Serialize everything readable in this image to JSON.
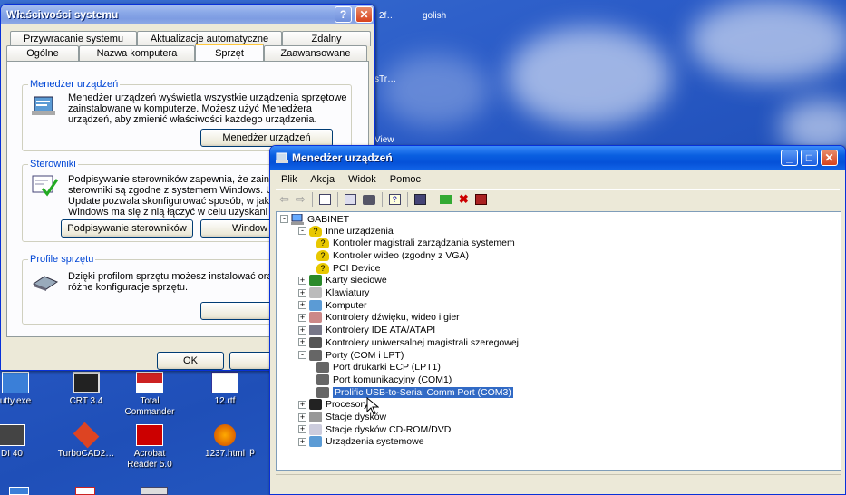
{
  "desktop": {
    "top_labels": [
      "2f…",
      "golish"
    ],
    "side_labels": [
      "sTr…",
      "View"
    ],
    "icons": [
      {
        "label": "utty.exe"
      },
      {
        "label": "CRT 3.4"
      },
      {
        "label": "Total Commander"
      },
      {
        "label": "12.rtf"
      },
      {
        "label": "DI 40"
      },
      {
        "label": "TurboCAD2…"
      },
      {
        "label": "Acrobat Reader 5.0"
      },
      {
        "label": "1237.html"
      },
      {
        "label": "p"
      }
    ]
  },
  "sysprops": {
    "title": "Właściwości systemu",
    "tabs_row1": [
      "Przywracanie systemu",
      "Aktualizacje automatyczne",
      "Zdalny"
    ],
    "tabs_row2": [
      "Ogólne",
      "Nazwa komputera",
      "Sprzęt",
      "Zaawansowane"
    ],
    "devmgr": {
      "label": "Menedżer urządzeń",
      "text": [
        "Menedżer urządzeń wyświetla wszystkie urządzenia sprzętowe",
        "zainstalowane w komputerze. Możesz użyć Menedżera",
        "urządzeń, aby zmienić właściwości każdego urządzenia."
      ],
      "button": "Menedżer urządzeń"
    },
    "drivers": {
      "label": "Sterowniki",
      "text": [
        "Podpisywanie sterowników zapewnia, że zains",
        "sterowniki są zgodne z systemem Windows. U",
        "Update pozwala skonfigurować sposób, w jak",
        "Windows ma się z nią łączyć w celu uzyskani"
      ],
      "button1": "Podpisywanie sterowników",
      "button2": "Window"
    },
    "profiles": {
      "label": "Profile sprzętu",
      "text": [
        "Dzięki profilom sprzętu możesz instalować oraz",
        "różne konfiguracje sprzętu."
      ],
      "button": "Profile"
    },
    "ok": "OK",
    "cancel": "Anul"
  },
  "devicemanager": {
    "title": "Menedżer urządzeń",
    "menu": [
      "Plik",
      "Akcja",
      "Widok",
      "Pomoc"
    ],
    "root": "GABINET",
    "tree": [
      {
        "label": "Inne urządzenia",
        "level": 1,
        "expander": "-",
        "icon": "unknown-device"
      },
      {
        "label": "Kontroler magistrali zarządzania systemem",
        "level": 2,
        "icon": "warning-device"
      },
      {
        "label": "Kontroler wideo (zgodny z VGA)",
        "level": 2,
        "icon": "warning-device"
      },
      {
        "label": "PCI Device",
        "level": 2,
        "icon": "warning-device"
      },
      {
        "label": "Karty sieciowe",
        "level": 1,
        "expander": "+",
        "icon": "network-card"
      },
      {
        "label": "Klawiatury",
        "level": 1,
        "expander": "+",
        "icon": "keyboard"
      },
      {
        "label": "Komputer",
        "level": 1,
        "expander": "+",
        "icon": "computer"
      },
      {
        "label": "Kontrolery dźwięku, wideo i gier",
        "level": 1,
        "expander": "+",
        "icon": "sound"
      },
      {
        "label": "Kontrolery IDE ATA/ATAPI",
        "level": 1,
        "expander": "+",
        "icon": "ide"
      },
      {
        "label": "Kontrolery uniwersalnej magistrali szeregowej",
        "level": 1,
        "expander": "+",
        "icon": "usb"
      },
      {
        "label": "Porty (COM i LPT)",
        "level": 1,
        "expander": "-",
        "icon": "port"
      },
      {
        "label": "Port drukarki ECP (LPT1)",
        "level": 2,
        "icon": "port"
      },
      {
        "label": "Port komunikacyjny (COM1)",
        "level": 2,
        "icon": "port"
      },
      {
        "label": "Prolific USB-to-Serial Comm Port (COM3)",
        "level": 2,
        "icon": "port",
        "selected": true
      },
      {
        "label": "Procesory",
        "level": 1,
        "expander": "+",
        "icon": "processor"
      },
      {
        "label": "Stacje dysków",
        "level": 1,
        "expander": "+",
        "icon": "floppy"
      },
      {
        "label": "Stacje dysków CD-ROM/DVD",
        "level": 1,
        "expander": "+",
        "icon": "cdrom"
      },
      {
        "label": "Urządzenia systemowe",
        "level": 1,
        "expander": "+",
        "icon": "system"
      }
    ]
  }
}
